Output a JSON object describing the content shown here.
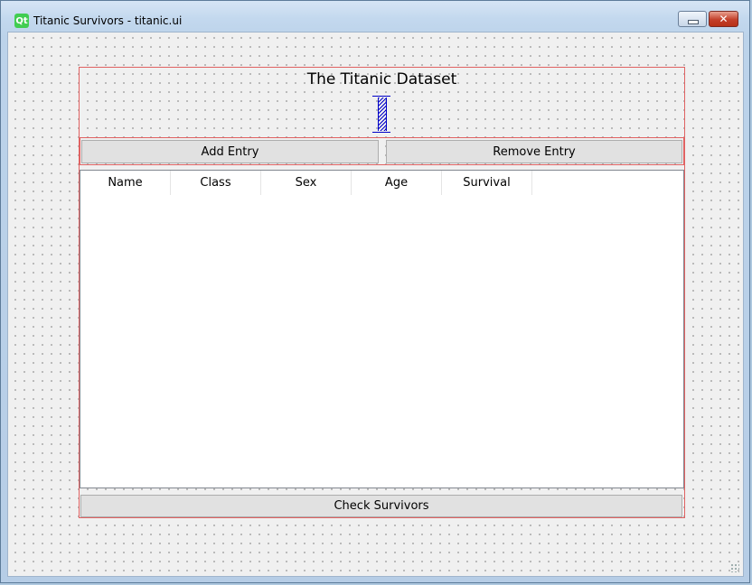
{
  "window": {
    "title": "Titanic Survivors - titanic.ui",
    "app_icon_text": "Qt",
    "minimize_icon": "minimize-icon",
    "close_glyph": "✕"
  },
  "form": {
    "heading": "The Titanic Dataset",
    "add_button": "Add Entry",
    "remove_button": "Remove Entry",
    "table_headers": [
      "Name",
      "Class",
      "Sex",
      "Age",
      "Survival"
    ],
    "check_button": "Check Survivors"
  },
  "colors": {
    "layout_outline": "#e06262",
    "spacer_blue": "#0000c8",
    "qt_green": "#41cd52"
  }
}
